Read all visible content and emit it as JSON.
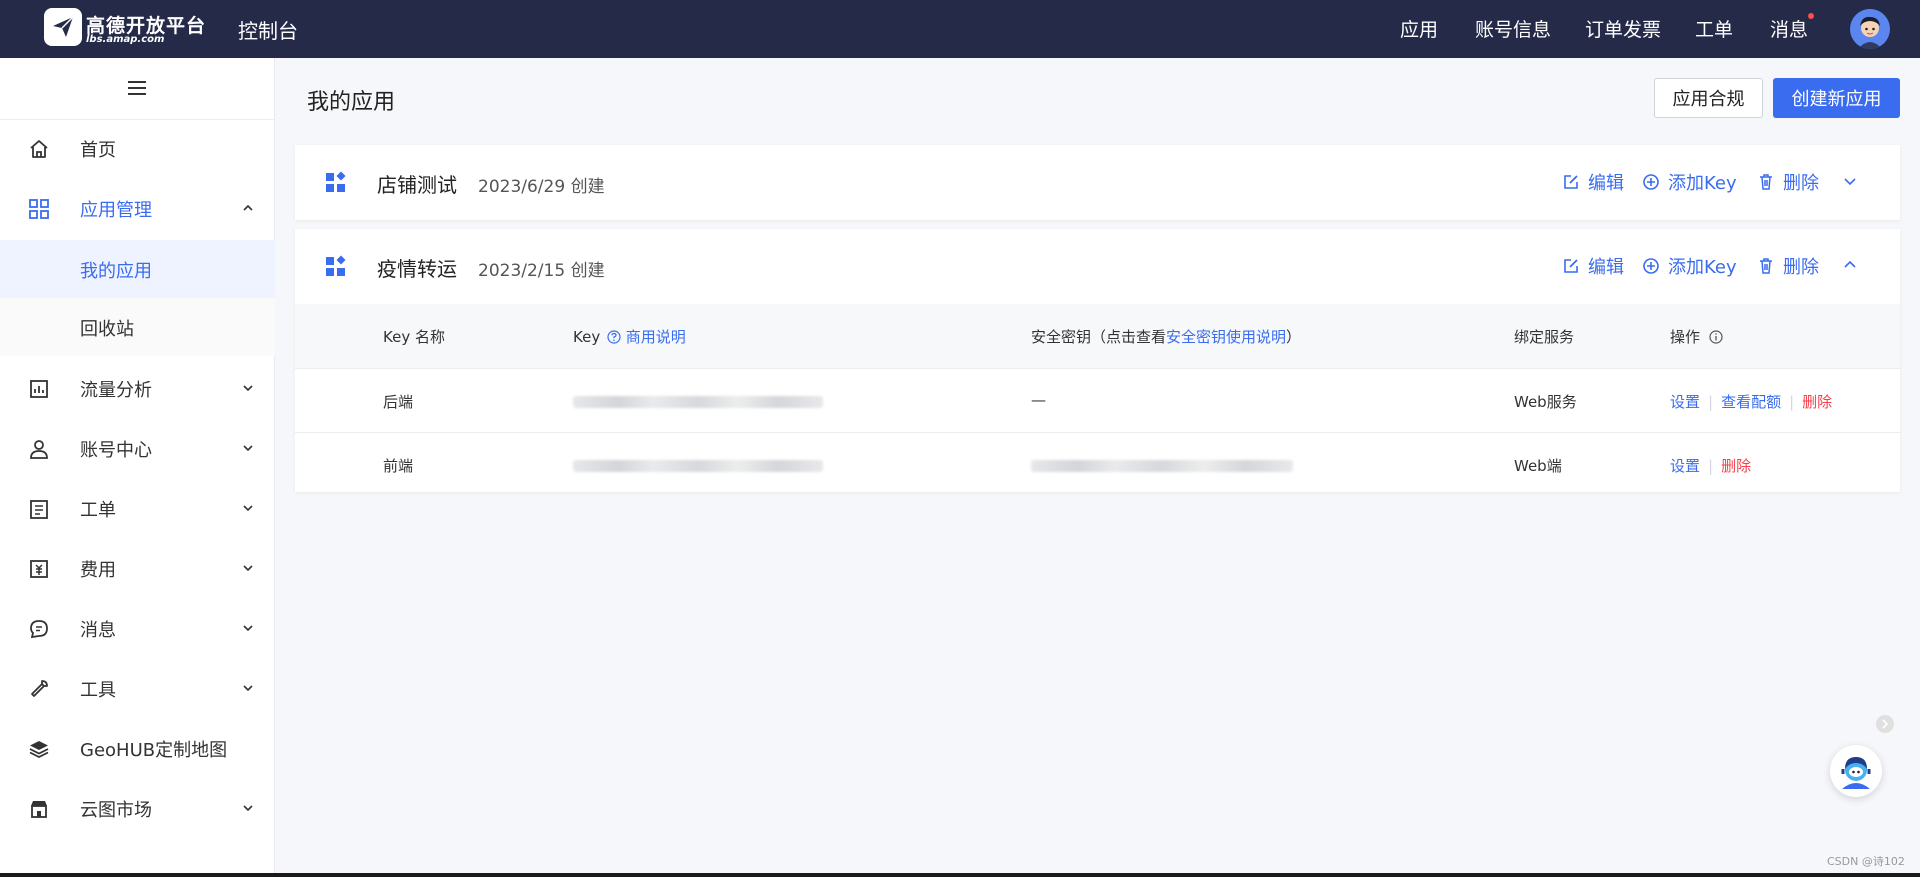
{
  "header": {
    "logo_name": "高德开放平台",
    "logo_url": "lbs.amap.com",
    "console_title": "控制台",
    "nav": [
      "应用",
      "账号信息",
      "订单发票",
      "工单",
      "消息"
    ],
    "message_unread": true
  },
  "sidebar": {
    "items": [
      {
        "label": "首页",
        "icon": "home-icon"
      },
      {
        "label": "应用管理",
        "icon": "apps-grid-icon",
        "expanded": true
      },
      {
        "label": "流量分析",
        "icon": "chart-icon"
      },
      {
        "label": "账号中心",
        "icon": "user-icon"
      },
      {
        "label": "工单",
        "icon": "ticket-icon"
      },
      {
        "label": "费用",
        "icon": "fee-icon"
      },
      {
        "label": "消息",
        "icon": "message-icon"
      },
      {
        "label": "工具",
        "icon": "wrench-icon"
      },
      {
        "label": "GeoHUB定制地图",
        "icon": "layers-icon"
      },
      {
        "label": "云图市场",
        "icon": "store-icon"
      }
    ],
    "sub_items": [
      {
        "label": "我的应用",
        "selected": true
      },
      {
        "label": "回收站",
        "selected": false
      }
    ]
  },
  "main": {
    "title": "我的应用",
    "compliance_button": "应用合规",
    "create_button": "创建新应用",
    "apps": [
      {
        "name": "店铺测试",
        "created": "2023/6/29 创建",
        "expanded": false
      },
      {
        "name": "疫情转运",
        "created": "2023/2/15 创建",
        "expanded": true
      }
    ],
    "actions": {
      "edit": "编辑",
      "add_key": "添加Key",
      "delete": "删除"
    },
    "table": {
      "col_key_name": "Key 名称",
      "col_key": "Key",
      "col_key_link": "商用说明",
      "col_secret_prefix": "安全密钥（点击查看",
      "col_secret_link": "安全密钥使用说明",
      "col_secret_suffix": "）",
      "col_service": "绑定服务",
      "col_ops": "操作",
      "rows": [
        {
          "name": "后端",
          "secret": "—",
          "service": "Web服务",
          "op_settings": "设置",
          "op_quota": "查看配额",
          "op_delete": "删除"
        },
        {
          "name": "前端",
          "secret": "",
          "service": "Web端",
          "op_settings": "设置",
          "op_delete": "删除"
        }
      ]
    }
  },
  "footer": {
    "watermark": "CSDN @诗102"
  },
  "colors": {
    "accent": "#3a6cf0",
    "topbar": "#242a48",
    "danger": "#f5414b"
  }
}
